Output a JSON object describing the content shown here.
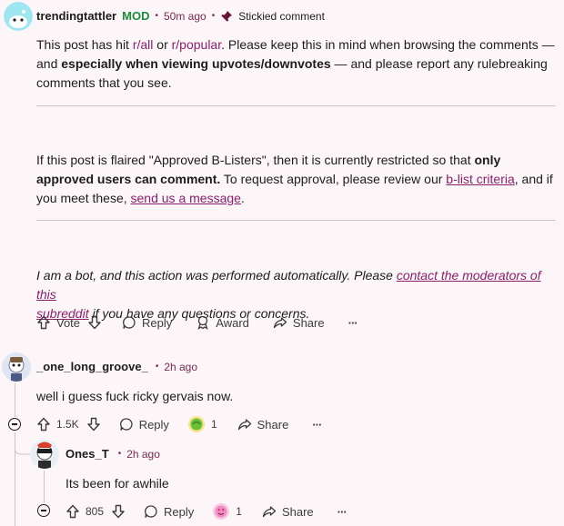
{
  "post_comment": {
    "username": "trendingtattler",
    "mod_badge": "MOD",
    "time": "50m ago",
    "stickied": "Stickied comment",
    "p1": {
      "t1": "This post has hit ",
      "link_all": "r/all",
      "t2": " or ",
      "link_popular": "r/popular",
      "t3": ". Please keep this in mind when browsing the comments —",
      "t4": "and ",
      "bold": "especially when viewing upvotes/downvotes",
      "t5": " — and please report any rulebreaking",
      "t6": "comments that you see."
    },
    "p2": {
      "t1": "If this post is flaired \"Approved B-Listers\", then it is currently restricted so that ",
      "bold1": "only",
      "bold2": "approved users can comment.",
      "t2": " To request approval, please review our ",
      "link_criteria": "b-list criteria",
      "t3": ", and if",
      "t4": "you meet these, ",
      "link_message": "send us a message",
      "t5": "."
    },
    "p3": {
      "t1": "I am a bot, and this action was performed automatically. Please ",
      "link_contact_a": "contact the moderators of this",
      "link_contact_b": "subreddit",
      "t2": " if you have any questions or concerns."
    },
    "actions": {
      "vote": "Vote",
      "reply": "Reply",
      "award": "Award",
      "share": "Share",
      "more": "···"
    }
  },
  "comment1": {
    "username": "_one_long_groove_",
    "time": "2h ago",
    "text": "well i guess fuck ricky gervais now.",
    "score": "1.5K",
    "reply": "Reply",
    "award_count": "1",
    "share": "Share",
    "more": "···"
  },
  "comment2": {
    "username": "Ones_T",
    "time": "2h ago",
    "text": "Its been for awhile",
    "score": "805",
    "reply": "Reply",
    "award_count": "1",
    "share": "Share",
    "more": "···"
  },
  "colors": {
    "background": "#fdf6f9",
    "mod_green": "#1a8d3a",
    "link": "#8a1f6b",
    "meta": "#7a2a4f"
  }
}
